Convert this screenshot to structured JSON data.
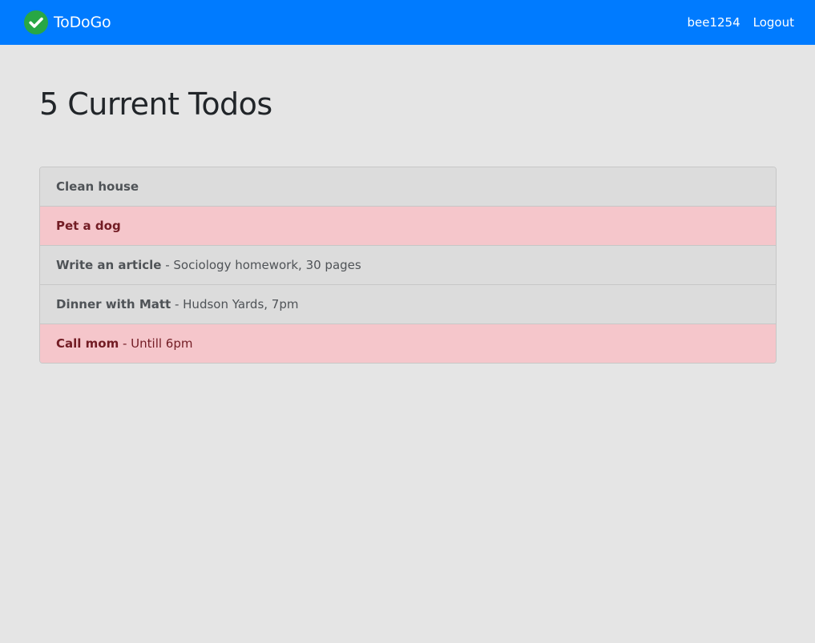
{
  "navbar": {
    "brand": "ToDoGo",
    "brand_icon": "check-circle-icon",
    "username": "bee1254",
    "logout_label": "Logout",
    "brand_color": "#007bff",
    "icon_color": "#28a745"
  },
  "main": {
    "heading": "5 Current Todos"
  },
  "todos": [
    {
      "title": "Clean house",
      "separator": "",
      "detail": "",
      "highlight": false
    },
    {
      "title": "Pet a dog",
      "separator": "",
      "detail": "",
      "highlight": true
    },
    {
      "title": "Write an article",
      "separator": " - ",
      "detail": "Sociology homework, 30 pages",
      "highlight": false
    },
    {
      "title": "Dinner with Matt",
      "separator": " - ",
      "detail": "Hudson Yards, 7pm",
      "highlight": false
    },
    {
      "title": "Call mom",
      "separator": " - ",
      "detail": "Untill 6pm",
      "highlight": true
    }
  ],
  "colors": {
    "highlight_background": "#f5c6cb",
    "highlight_text": "#721c24",
    "normal_background": "#dcdcdc"
  }
}
